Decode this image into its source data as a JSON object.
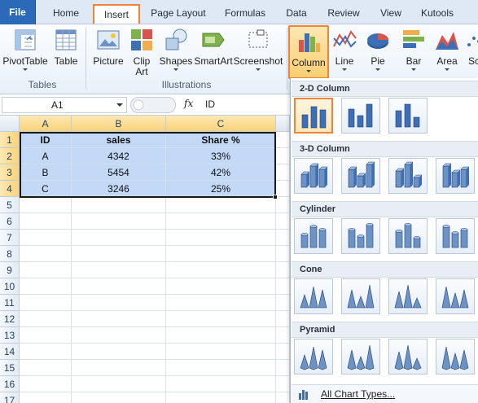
{
  "tabs": {
    "file": "File",
    "home": "Home",
    "insert": "Insert",
    "page_layout": "Page Layout",
    "formulas": "Formulas",
    "data": "Data",
    "review": "Review",
    "view": "View",
    "kutools": "Kutools"
  },
  "ribbon": {
    "pivottable": "PivotTable",
    "table": "Table",
    "picture": "Picture",
    "clip_art_1": "Clip",
    "clip_art_2": "Art",
    "shapes": "Shapes",
    "smartart": "SmartArt",
    "screenshot": "Screenshot",
    "column": "Column",
    "line": "Line",
    "pie": "Pie",
    "bar": "Bar",
    "area": "Area",
    "scatter": "Sc",
    "group_tables": "Tables",
    "group_illustrations": "Illustrations"
  },
  "formula_bar": {
    "name_box": "A1",
    "fx": "fx",
    "value": "ID"
  },
  "sheet": {
    "columns": [
      "A",
      "B",
      "C"
    ],
    "rows": [
      "1",
      "2",
      "3",
      "4",
      "5",
      "6",
      "7",
      "8",
      "9",
      "10",
      "11",
      "12",
      "13",
      "14",
      "15",
      "16",
      "17"
    ],
    "headers": [
      "ID",
      "sales",
      "Share %"
    ],
    "data": [
      [
        "A",
        "4342",
        "33%"
      ],
      [
        "B",
        "5454",
        "42%"
      ],
      [
        "C",
        "3246",
        "25%"
      ]
    ]
  },
  "dropdown": {
    "sections": {
      "col2d": "2-D Column",
      "col3d": "3-D Column",
      "cylinder": "Cylinder",
      "cone": "Cone",
      "pyramid": "Pyramid"
    },
    "all_chart_types": "All Chart Types..."
  },
  "colors": {
    "accent_orange": "#f0823b",
    "file_tab": "#2a6ab8",
    "selection": "#c2d9f7",
    "chart_blue": "#3d6fb6"
  }
}
